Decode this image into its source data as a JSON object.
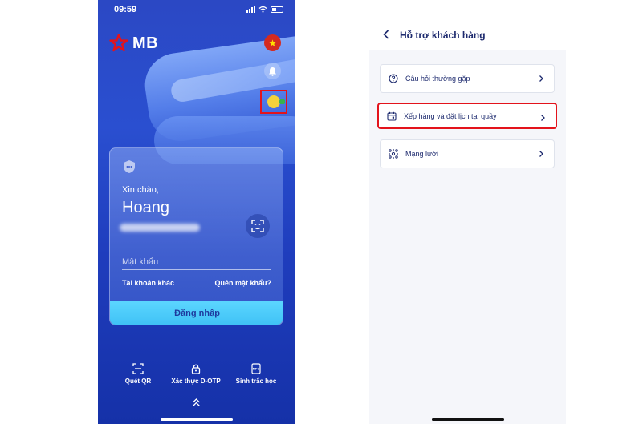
{
  "left_screen": {
    "status_bar": {
      "time": "09:59"
    },
    "brand": {
      "name": "MB"
    },
    "login_card": {
      "greeting": "Xin chào,",
      "username": "Hoang",
      "password_placeholder": "Mật khẩu",
      "other_account_label": "Tài khoản khác",
      "forgot_password_label": "Quên mật khẩu?",
      "login_button_label": "Đăng nhập"
    },
    "quick_actions": [
      {
        "label": "Quét QR",
        "icon": "qr-scan-icon"
      },
      {
        "label": "Xác thực D-OTP",
        "icon": "lock-icon"
      },
      {
        "label": "Sinh trắc học",
        "icon": "nfc-card-icon"
      }
    ]
  },
  "right_screen": {
    "header": {
      "title": "Hỗ trợ khách hàng"
    },
    "menu": [
      {
        "label": "Câu hỏi thường gặp",
        "icon": "question-circle-icon"
      },
      {
        "label": "Xếp hàng và đặt lịch tại quầy",
        "icon": "calendar-icon",
        "highlighted": true
      },
      {
        "label": "Mạng lưới",
        "icon": "network-icon"
      }
    ]
  },
  "colors": {
    "brand_blue": "#2a4fd0",
    "login_button": "#3ec1f5",
    "highlight_red": "#e3131b",
    "text_navy": "#1d2a6e"
  }
}
